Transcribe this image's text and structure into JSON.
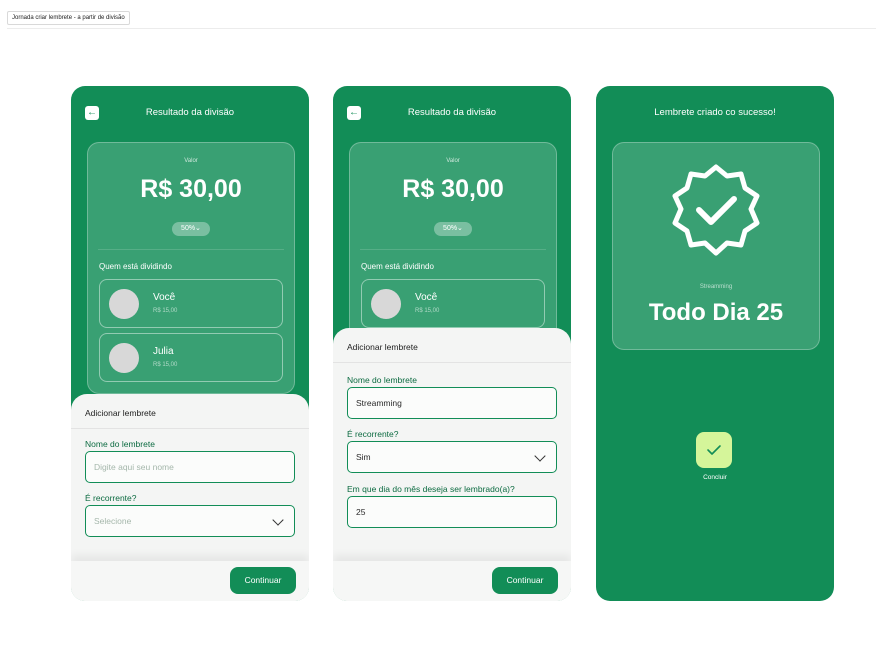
{
  "page": {
    "label": "Jornada criar lembrete - a partir de divisão"
  },
  "screen1": {
    "header_title": "Resultado da divisão",
    "value_label": "Valor",
    "amount": "R$ 30,00",
    "percent": "50%⌄",
    "who_label": "Quem está dividindo",
    "people": [
      {
        "name": "Você",
        "amount": "R$ 15,00"
      },
      {
        "name": "Julia",
        "amount": "R$ 15,00"
      }
    ],
    "sheet": {
      "title": "Adicionar lembrete",
      "name_label": "Nome do lembrete",
      "name_placeholder": "Digite aqui seu nome",
      "recurring_label": "É recorrente?",
      "recurring_placeholder": "Selecione"
    },
    "continue_label": "Continuar"
  },
  "screen2": {
    "header_title": "Resultado da divisão",
    "value_label": "Valor",
    "amount": "R$ 30,00",
    "percent": "50%⌄",
    "who_label": "Quem está dividindo",
    "people": [
      {
        "name": "Você",
        "amount": "R$ 15,00"
      }
    ],
    "sheet": {
      "title": "Adicionar lembrete",
      "name_label": "Nome do lembrete",
      "name_value": "Streamming",
      "recurring_label": "É recorrente?",
      "recurring_value": "Sim",
      "day_label": "Em que dia do mês deseja ser lembrado(a)?",
      "day_value": "25"
    },
    "continue_label": "Continuar"
  },
  "screen3": {
    "header_title": "Lembrete criado co sucesso!",
    "subtitle": "Streamming",
    "big_text": "Todo Dia 25",
    "done_label": "Concluir",
    "icons": {
      "badge": "check-badge-icon",
      "done": "check-icon"
    }
  },
  "colors": {
    "primary": "#128d57",
    "sheet": "#f4f5f4",
    "accent": "#d5f59a"
  }
}
